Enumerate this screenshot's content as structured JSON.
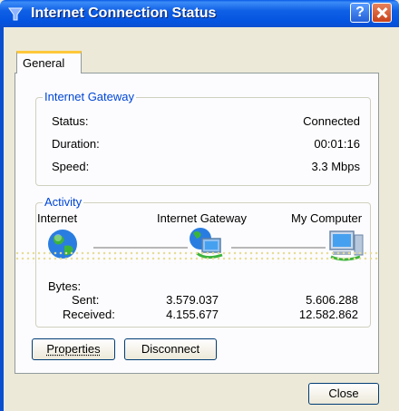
{
  "window": {
    "title": "Internet Connection Status"
  },
  "tabs": [
    {
      "label": "General"
    }
  ],
  "gateway": {
    "title": "Internet Gateway",
    "rows": [
      {
        "label": "Status:",
        "value": "Connected"
      },
      {
        "label": "Duration:",
        "value": "00:01:16"
      },
      {
        "label": "Speed:",
        "value": "3.3 Mbps"
      }
    ]
  },
  "activity": {
    "title": "Activity",
    "nodes": [
      {
        "label": "Internet",
        "icon": "globe-icon"
      },
      {
        "label": "Internet Gateway",
        "icon": "gateway-icon"
      },
      {
        "label": "My Computer",
        "icon": "computer-icon"
      }
    ],
    "bytes_label": "Bytes:",
    "sent_label": "Sent:",
    "received_label": "Received:",
    "gateway_sent": "3.579.037",
    "gateway_received": "4.155.677",
    "computer_sent": "5.606.288",
    "computer_received": "12.582.862"
  },
  "buttons": {
    "properties": "Properties",
    "disconnect": "Disconnect",
    "close": "Close"
  }
}
